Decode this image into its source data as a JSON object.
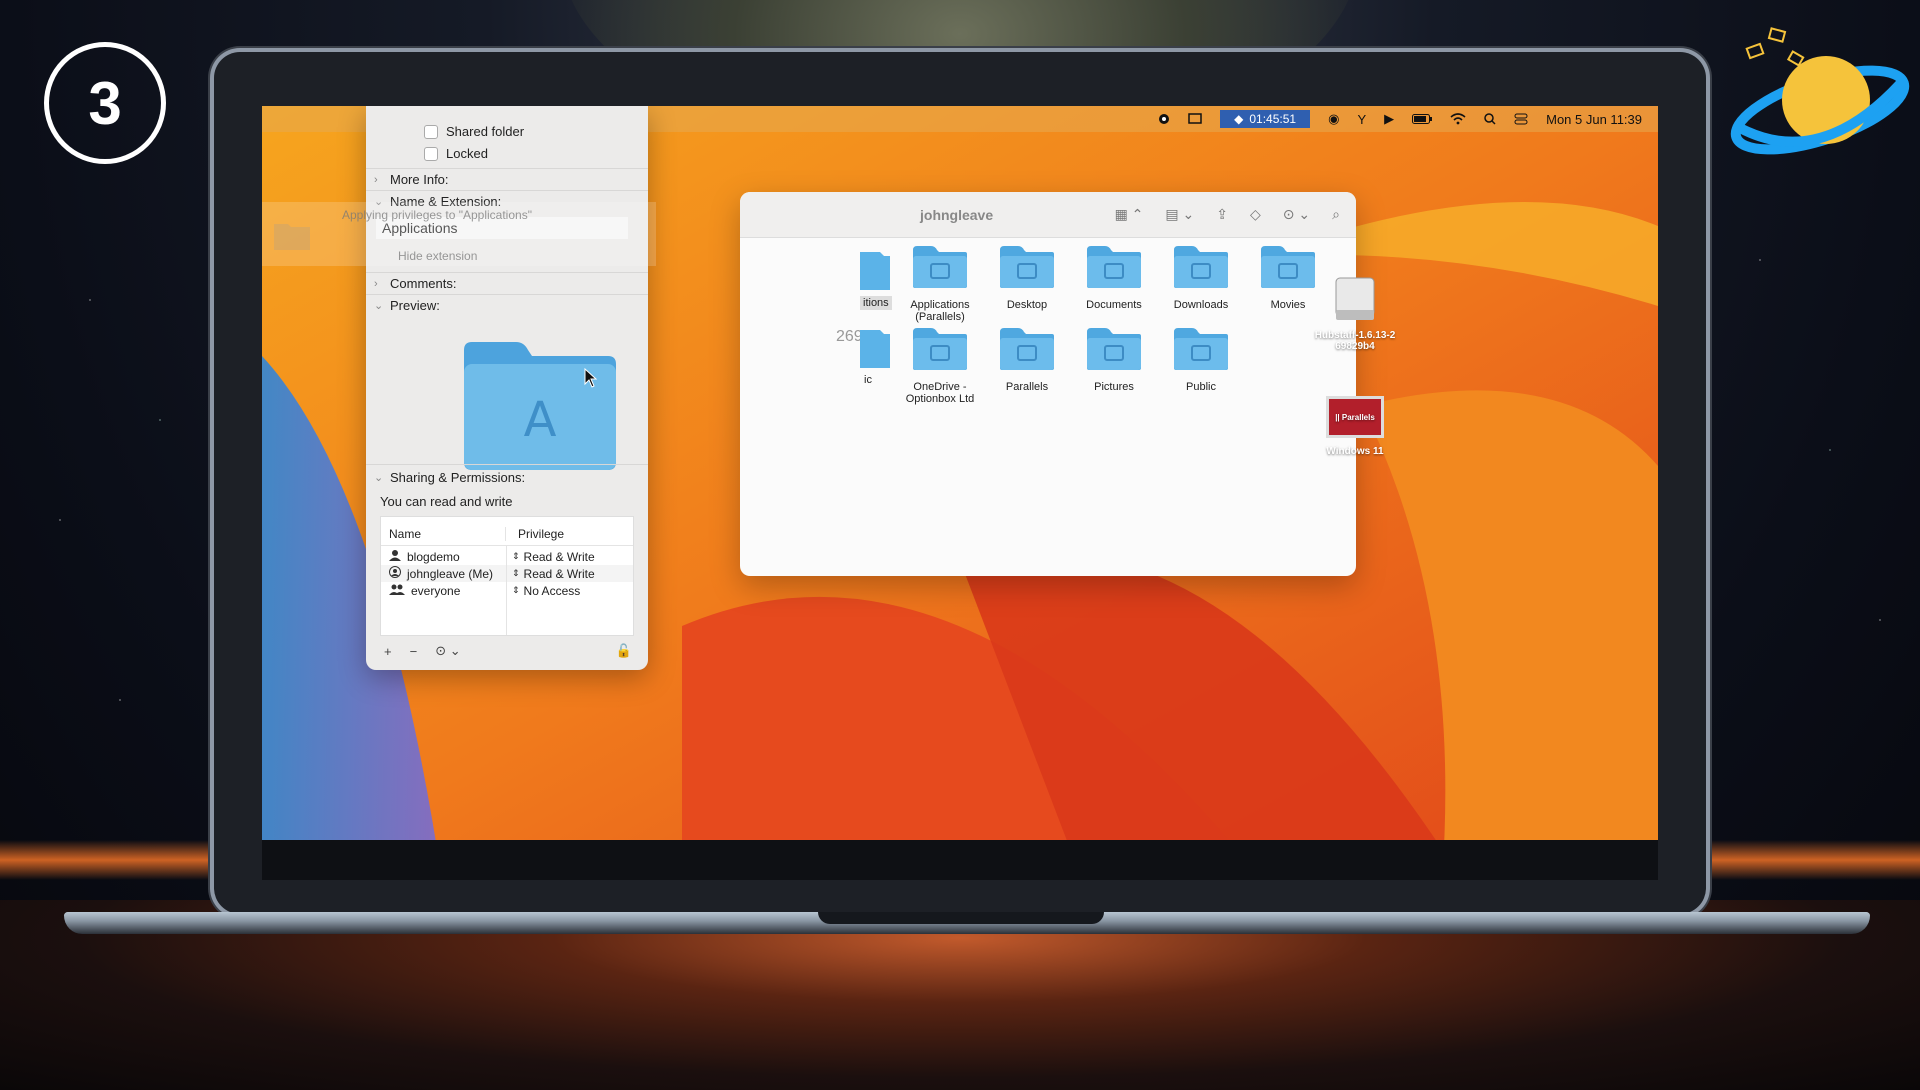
{
  "step": {
    "number": "3"
  },
  "menubar": {
    "timer": "01:45:51",
    "datetime": "Mon 5 Jun  11:39",
    "icons": [
      "record-icon",
      "screen-mirror-icon",
      "hubstaff-icon",
      "vpn-icon",
      "cooling-icon",
      "play-icon",
      "battery-icon",
      "wifi-icon",
      "spotlight-icon",
      "control-center-icon"
    ]
  },
  "finder": {
    "title": "johngleave",
    "partial_labels": {
      "applications": "itions",
      "music": "ic",
      "counter": "269"
    },
    "folders": [
      {
        "label": "Applications\n(Parallels)",
        "icon": "parallels-folder-icon"
      },
      {
        "label": "Desktop",
        "icon": "desktop-folder-icon"
      },
      {
        "label": "Documents",
        "icon": "documents-folder-icon"
      },
      {
        "label": "Downloads",
        "icon": "downloads-folder-icon"
      },
      {
        "label": "Movies",
        "icon": "movies-folder-icon"
      },
      {
        "label": "OneDrive -\nOptionbox Ltd",
        "icon": "onedrive-folder-icon"
      },
      {
        "label": "Parallels",
        "icon": "folder-icon"
      },
      {
        "label": "Pictures",
        "icon": "pictures-folder-icon"
      },
      {
        "label": "Public",
        "icon": "public-folder-icon"
      }
    ]
  },
  "info": {
    "shared_folder": "Shared folder",
    "locked": "Locked",
    "more_info": "More Info:",
    "name_extension": "Name & Extension:",
    "applying": "Applying privileges to \"Applications\"",
    "name_value": "Applications",
    "hide_extension": "Hide extension",
    "comments": "Comments:",
    "preview": "Preview:",
    "sharing": "Sharing & Permissions:",
    "can_read_write": "You can read and write",
    "table": {
      "col_name": "Name",
      "col_privilege": "Privilege",
      "rows": [
        {
          "name": "blogdemo",
          "privilege": "Read & Write",
          "icon": "user-icon"
        },
        {
          "name": "johngleave (Me)",
          "privilege": "Read & Write",
          "icon": "user-circle-icon"
        },
        {
          "name": "everyone",
          "privilege": "No Access",
          "icon": "group-icon"
        }
      ]
    },
    "add": "+",
    "remove": "−",
    "actions": "⊙ ⌄"
  },
  "desktop": {
    "hubstaff": "Hubstaff-1.6.13-2\n69829b4",
    "windows": "Windows 11",
    "parallels_badge": "|| Parallels"
  }
}
